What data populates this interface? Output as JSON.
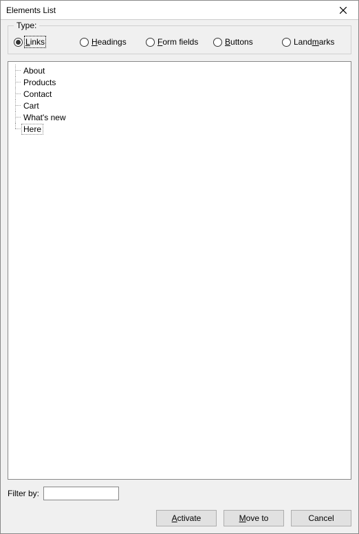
{
  "window": {
    "title": "Elements List"
  },
  "type_group": {
    "label": "Type:",
    "options": [
      {
        "pre": "",
        "hot": "L",
        "post": "inks",
        "selected": true
      },
      {
        "pre": "",
        "hot": "H",
        "post": "eadings",
        "selected": false
      },
      {
        "pre": "",
        "hot": "F",
        "post": "orm fields",
        "selected": false
      },
      {
        "pre": "",
        "hot": "B",
        "post": "uttons",
        "selected": false
      },
      {
        "pre": "Land",
        "hot": "m",
        "post": "arks",
        "selected": false
      }
    ]
  },
  "items": [
    "About",
    "Products",
    "Contact",
    "Cart",
    "What's new",
    "Here"
  ],
  "selected_index": 5,
  "filter": {
    "label": "Filter by:",
    "value": ""
  },
  "buttons": {
    "activate": {
      "pre": "",
      "hot": "A",
      "post": "ctivate"
    },
    "moveto": {
      "pre": "",
      "hot": "M",
      "post": "ove to"
    },
    "cancel": {
      "text": "Cancel"
    }
  }
}
